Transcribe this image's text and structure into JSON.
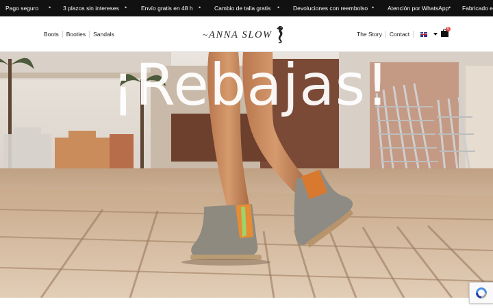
{
  "announcement_bar": {
    "messages": [
      "Pago seguro",
      "3 plazos sin intereses",
      "Envío gratis en 48 h",
      "Cambio de talla gratis",
      "Devoluciones con reembolso",
      "Atención por WhatsApp",
      "Fabricado en"
    ],
    "separator": "•"
  },
  "header": {
    "nav_left": [
      {
        "label": "Boots"
      },
      {
        "label": "Booties"
      },
      {
        "label": "Sandals"
      }
    ],
    "logo": {
      "tilde": "~",
      "text": "ANNA SLOW",
      "icon": "seahorse-icon"
    },
    "nav_right": [
      {
        "label": "The Story"
      },
      {
        "label": "Contact"
      }
    ],
    "language": {
      "icon": "uk-flag-icon"
    },
    "cart": {
      "count": "0",
      "icon": "shopping-bag-icon"
    }
  },
  "hero": {
    "headline": "¡Rebajas!"
  },
  "recaptcha": {
    "icon": "recaptcha-icon"
  },
  "colors": {
    "announcement_bg": "#111111",
    "announcement_text": "#ffffff",
    "header_bg": "#ffffff",
    "text_dark": "#1a1a1a",
    "cart_badge": "#e05353",
    "hero_text": "#ffffff"
  }
}
